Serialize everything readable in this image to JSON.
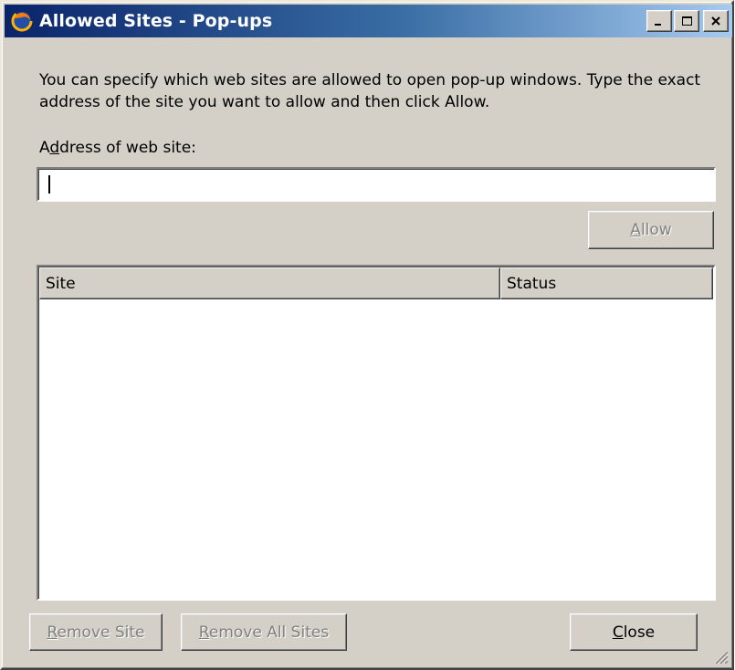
{
  "window": {
    "title": "Allowed Sites - Pop-ups",
    "icon": "firefox-icon",
    "controls": [
      "minimize-icon",
      "maximize-icon",
      "close-icon"
    ]
  },
  "description": "You can specify which web sites are allowed to open pop-up windows. Type the exact address of the site you want to allow and then click Allow.",
  "address": {
    "label_pre": "A",
    "label_accel": "d",
    "label_post": "dress of web site:",
    "value": ""
  },
  "allow_button": {
    "accel": "A",
    "rest": "llow",
    "enabled": false
  },
  "list": {
    "columns": [
      "Site",
      "Status"
    ],
    "rows": []
  },
  "buttons": {
    "remove_site": {
      "accel": "R",
      "rest": "emove Site",
      "enabled": false
    },
    "remove_all": {
      "accel": "R",
      "rest": "emove All Sites",
      "enabled": false
    },
    "close": {
      "accel": "C",
      "rest": "lose",
      "enabled": true
    }
  },
  "colors": {
    "titlebar_start": "#0a246a",
    "titlebar_end": "#a6caf0",
    "face": "#d4d0c8"
  }
}
